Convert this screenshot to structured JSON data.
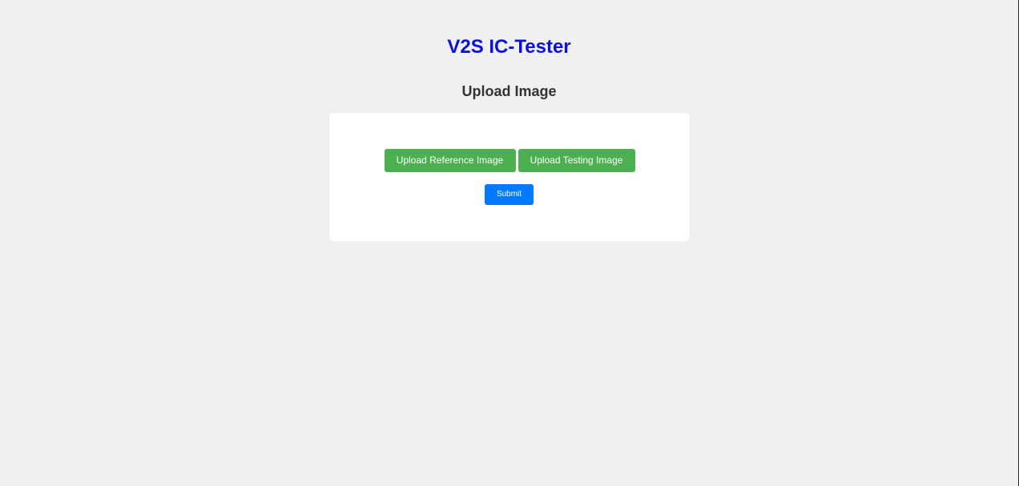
{
  "header": {
    "app_title": "V2S IC-Tester",
    "section_title": "Upload Image"
  },
  "upload_form": {
    "upload_reference_label": "Upload Reference Image",
    "upload_testing_label": "Upload Testing Image",
    "submit_label": "Submit"
  },
  "colors": {
    "background": "#f0f0f0",
    "title": "#0a10e0",
    "upload_button": "#4caf50",
    "submit_button": "#007bff",
    "card": "#ffffff"
  }
}
